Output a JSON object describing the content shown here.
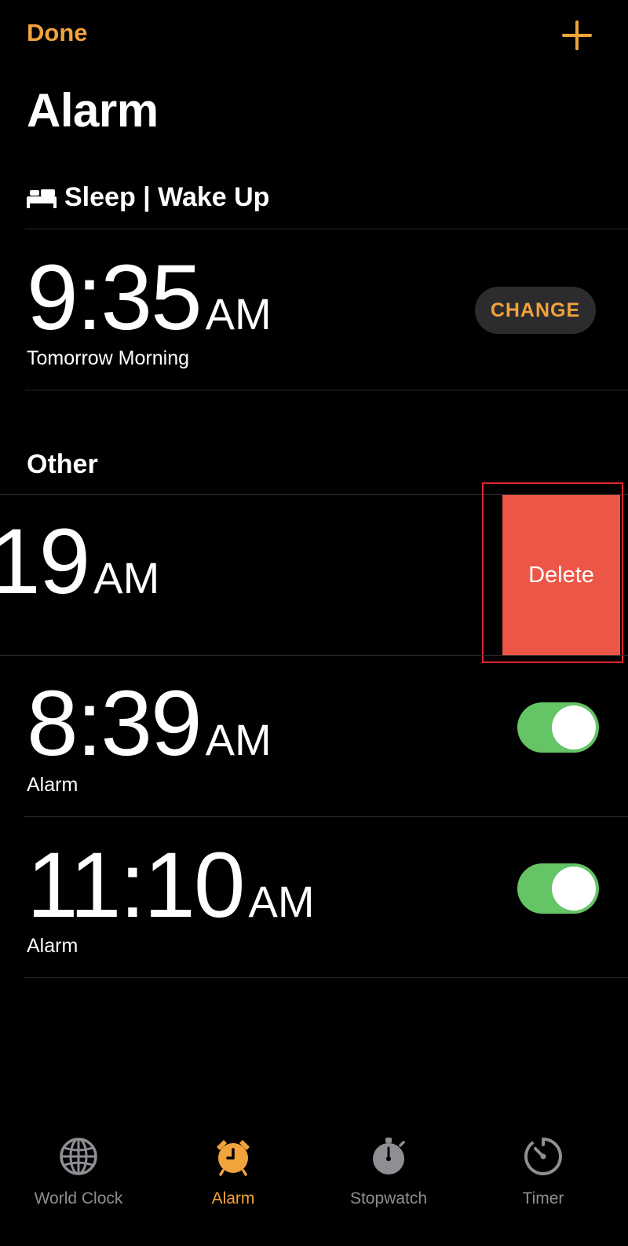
{
  "header": {
    "done_label": "Done",
    "add_icon": "plus-icon",
    "title": "Alarm"
  },
  "sleep_section": {
    "icon": "bed-icon",
    "title": "Sleep | Wake Up",
    "time": "9:35",
    "ampm": "AM",
    "subtitle": "Tomorrow Morning",
    "change_label": "CHANGE"
  },
  "other_section": {
    "title": "Other"
  },
  "alarms": [
    {
      "time_fragment": "19",
      "ampm": "AM",
      "delete_label": "Delete"
    },
    {
      "time": "8:39",
      "ampm": "AM",
      "label": "Alarm",
      "enabled": true
    },
    {
      "time": "11:10",
      "ampm": "AM",
      "label": "Alarm",
      "enabled": true
    }
  ],
  "tabs": [
    {
      "label": "World Clock",
      "icon": "globe-icon",
      "active": false
    },
    {
      "label": "Alarm",
      "icon": "alarm-clock-icon",
      "active": true
    },
    {
      "label": "Stopwatch",
      "icon": "stopwatch-icon",
      "active": false
    },
    {
      "label": "Timer",
      "icon": "timer-icon",
      "active": false
    }
  ],
  "colors": {
    "accent": "#f1a33c",
    "toggle_on": "#65c466",
    "delete": "#ec5647",
    "highlight_border": "#e0252d"
  }
}
